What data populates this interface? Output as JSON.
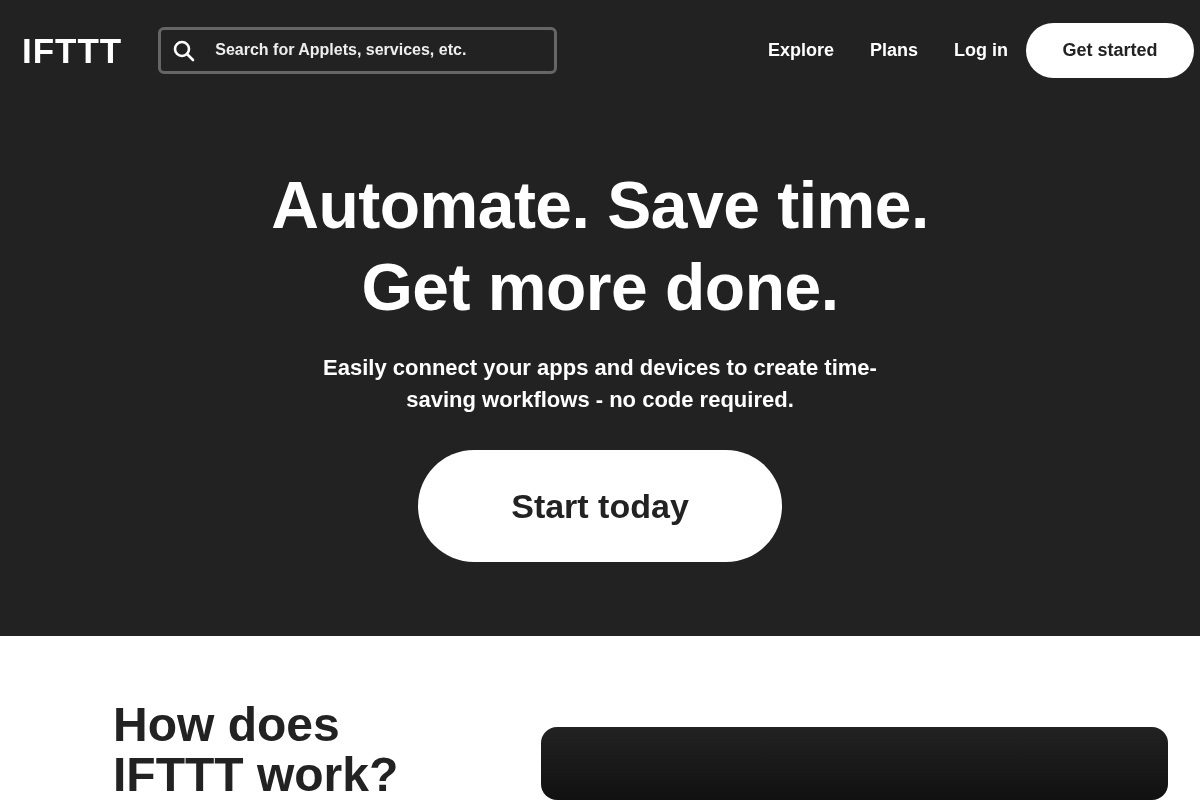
{
  "header": {
    "logo": "IFTTT",
    "search": {
      "placeholder": "Search for Applets, services, etc."
    },
    "nav": [
      "Explore",
      "Plans",
      "Log in"
    ],
    "cta": "Get started"
  },
  "hero": {
    "title_lines": [
      "Automate. Save time.",
      "Get more done."
    ],
    "subtitle": "Easily connect your apps and devices to create time-saving workflows - no code required.",
    "button": "Start today"
  },
  "how": {
    "title": "How does IFTTT work?"
  }
}
